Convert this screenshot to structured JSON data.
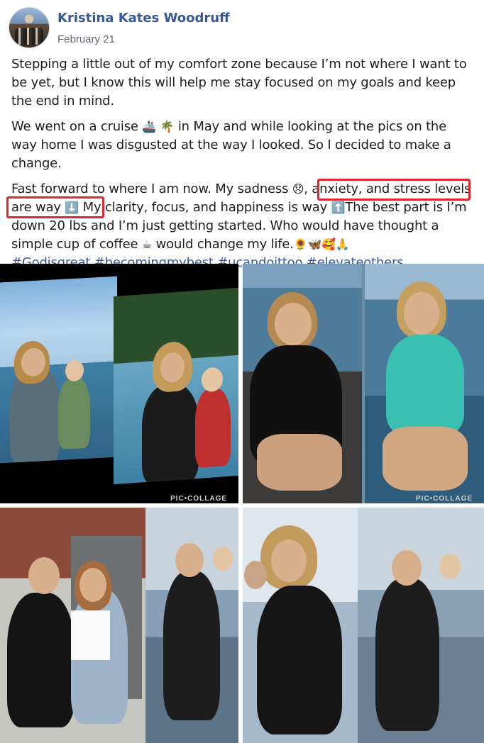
{
  "post": {
    "author": "Kristina Kates Woodruff",
    "date": "February 21",
    "p1": "Stepping a little out of my comfort zone because I’m not where I want to be yet, but I know this will help me stay focused on my goals and keep the end in mind.",
    "p2_a": "We went on a cruise",
    "p2_b": "in May and while looking at the pics on the way home I was disgusted at the way I looked. So I decided to make a change.",
    "p3_a": "Fast forward to where I am now. My sadness",
    "p3_b": ", anxiety, and stress levels are way",
    "p3_c": "My clarity, focus, and happiness is way",
    "p3_d": "The best part is I’m down 20 lbs and I’m just getting started. Who would have thought a simple cup of coffee",
    "p3_e": "would change my life.",
    "hashtags": "#Godisgreat #becomingmybest #ucandoittoo #elevateothers"
  },
  "emoji": {
    "ship": "🚢",
    "palm": "🌴",
    "sad": "😞",
    "down": "⬇️",
    "up": "⬆️",
    "coffee": "☕",
    "end": "🌻🦋🥰🙏"
  },
  "watermarks": {
    "w1": "PIC•COLLAGE",
    "w2": "PIC•COLLAGE"
  },
  "colors": {
    "link": "#385898",
    "highlight": "#e0262f"
  }
}
